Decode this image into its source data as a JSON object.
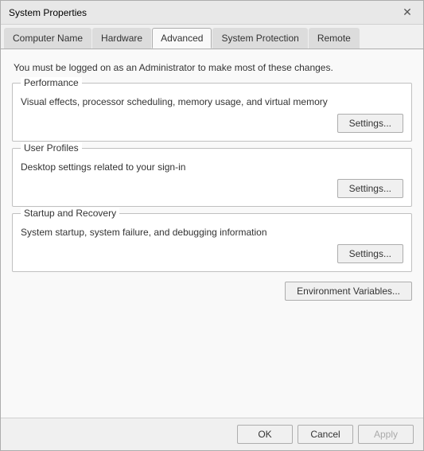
{
  "window": {
    "title": "System Properties"
  },
  "tabs": [
    {
      "label": "Computer Name",
      "active": false
    },
    {
      "label": "Hardware",
      "active": false
    },
    {
      "label": "Advanced",
      "active": true
    },
    {
      "label": "System Protection",
      "active": false
    },
    {
      "label": "Remote",
      "active": false
    }
  ],
  "content": {
    "admin_notice": "You must be logged on as an Administrator to make most of these changes.",
    "performance": {
      "label": "Performance",
      "description": "Visual effects, processor scheduling, memory usage, and virtual memory",
      "settings_btn": "Settings..."
    },
    "user_profiles": {
      "label": "User Profiles",
      "description": "Desktop settings related to your sign-in",
      "settings_btn": "Settings..."
    },
    "startup_recovery": {
      "label": "Startup and Recovery",
      "description": "System startup, system failure, and debugging information",
      "settings_btn": "Settings..."
    },
    "env_variables_btn": "Environment Variables..."
  },
  "bottom_buttons": {
    "ok": "OK",
    "cancel": "Cancel",
    "apply": "Apply"
  }
}
